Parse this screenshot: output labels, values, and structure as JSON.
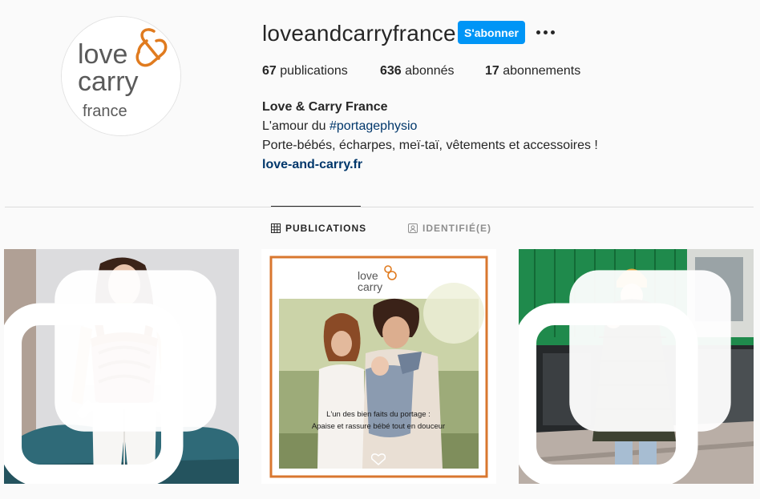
{
  "profile": {
    "username": "loveandcarryfrance",
    "follow_label": "S'abonner",
    "more_icon": "more-horizontal-icon",
    "avatar": {
      "brand_line1": "love",
      "brand_line2": "carry",
      "brand_line3": "france",
      "brand_color": "#5a5a5a",
      "accent_color": "#e07b1f"
    },
    "stats": {
      "posts_count": "67",
      "posts_label": "publications",
      "followers_count": "636",
      "followers_label": "abonnés",
      "following_count": "17",
      "following_label": "abonnements"
    },
    "bio": {
      "name": "Love & Carry France",
      "line1_prefix": "L'amour du ",
      "line1_hashtag": "#portagephysio",
      "line2": "Porte-bébés, écharpes, meï-taï, vêtements et accessoires !",
      "website": "love-and-carry.fr"
    }
  },
  "tabs": [
    {
      "label": "PUBLICATIONS",
      "icon": "grid-icon",
      "active": true
    },
    {
      "label": "IDENTIFIÉ(E)",
      "icon": "tagged-user-icon",
      "active": false
    }
  ],
  "posts": [
    {
      "icon": "multiple-photos-icon"
    },
    {
      "brand_line1": "love",
      "brand_line2": "carry",
      "caption_line1": "L'un des bien faits du portage :",
      "caption_line2": "Apaise et rassure bébé tout en douceur"
    },
    {
      "icon": "multiple-photos-icon"
    }
  ],
  "colors": {
    "primary_button": "#0095f6",
    "link": "#00376b",
    "border": "#dbdbdb",
    "muted": "#8e8e8e",
    "frame_orange": "#d9772f"
  }
}
